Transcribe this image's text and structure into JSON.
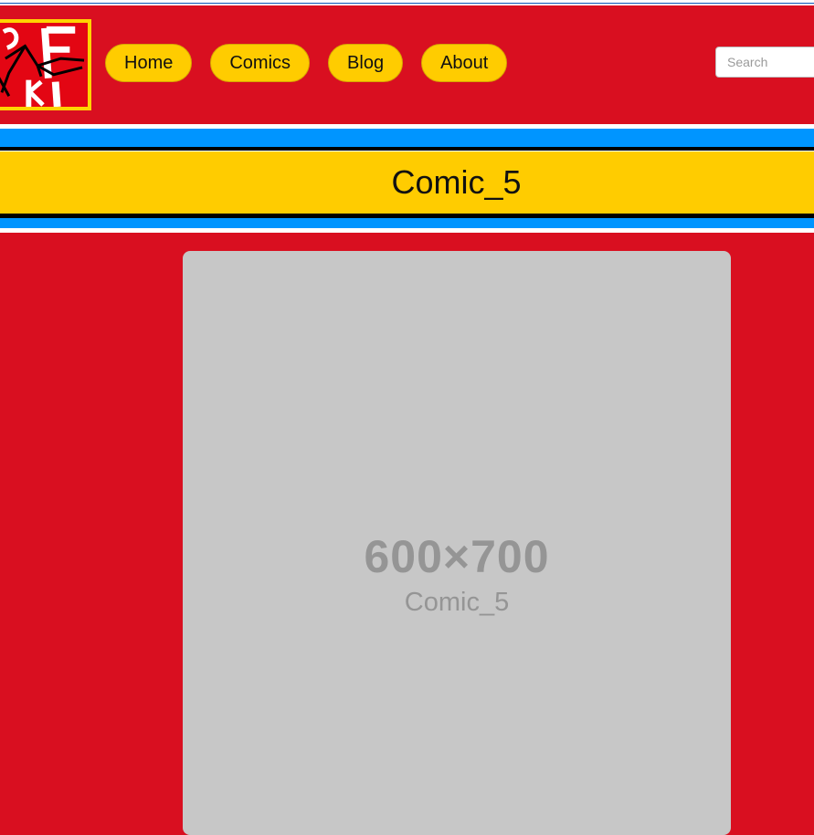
{
  "header": {
    "nav": [
      {
        "label": "Home"
      },
      {
        "label": "Comics"
      },
      {
        "label": "Blog"
      },
      {
        "label": "About"
      }
    ],
    "search": {
      "placeholder": "Search"
    }
  },
  "page": {
    "title": "Comic_5"
  },
  "comic": {
    "dimensions": "600×700",
    "caption": "Comic_5"
  },
  "colors": {
    "background": "#d90f20",
    "nav_button": "#ffcc00",
    "stripe_blue": "#0095ff",
    "title_bar": "#ffcc00",
    "placeholder": "#c7c7c7"
  }
}
